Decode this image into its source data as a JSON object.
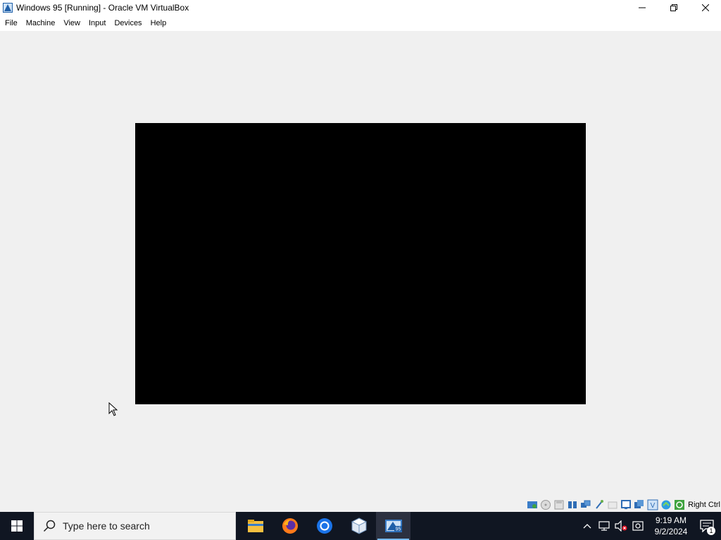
{
  "window": {
    "title": "Windows 95 [Running] - Oracle VM VirtualBox",
    "icon": "virtualbox-icon",
    "controls": [
      "minimize-icon",
      "restore-icon",
      "close-icon"
    ]
  },
  "menu": {
    "items": [
      "File",
      "Machine",
      "View",
      "Input",
      "Devices",
      "Help"
    ]
  },
  "vm": {
    "screen_color": "#000000"
  },
  "statusbar": {
    "icons": [
      "hard-disk-icon",
      "optical-disk-icon",
      "floppy-icon",
      "audio-icon",
      "network-icon",
      "usb-icon",
      "shared-folders-icon",
      "display-icon",
      "video-capture-icon",
      "virtualization-icon",
      "mouse-integration-icon",
      "host-key-icon"
    ],
    "host_key": "Right Ctrl"
  },
  "taskbar": {
    "search_placeholder": "Type here to search",
    "apps": [
      "file-explorer-icon",
      "firefox-icon",
      "chrome-icon",
      "virtualbox-manager-icon",
      "virtualbox-vm-icon"
    ],
    "tray": {
      "icons": [
        "chevron-up-icon",
        "network-icon",
        "volume-muted-icon",
        "security-icon"
      ],
      "time": "9:19 AM",
      "date": "9/2/2024",
      "notification_count": "1"
    },
    "colors": {
      "background": "#101622",
      "accent": "#76b9ed"
    }
  }
}
